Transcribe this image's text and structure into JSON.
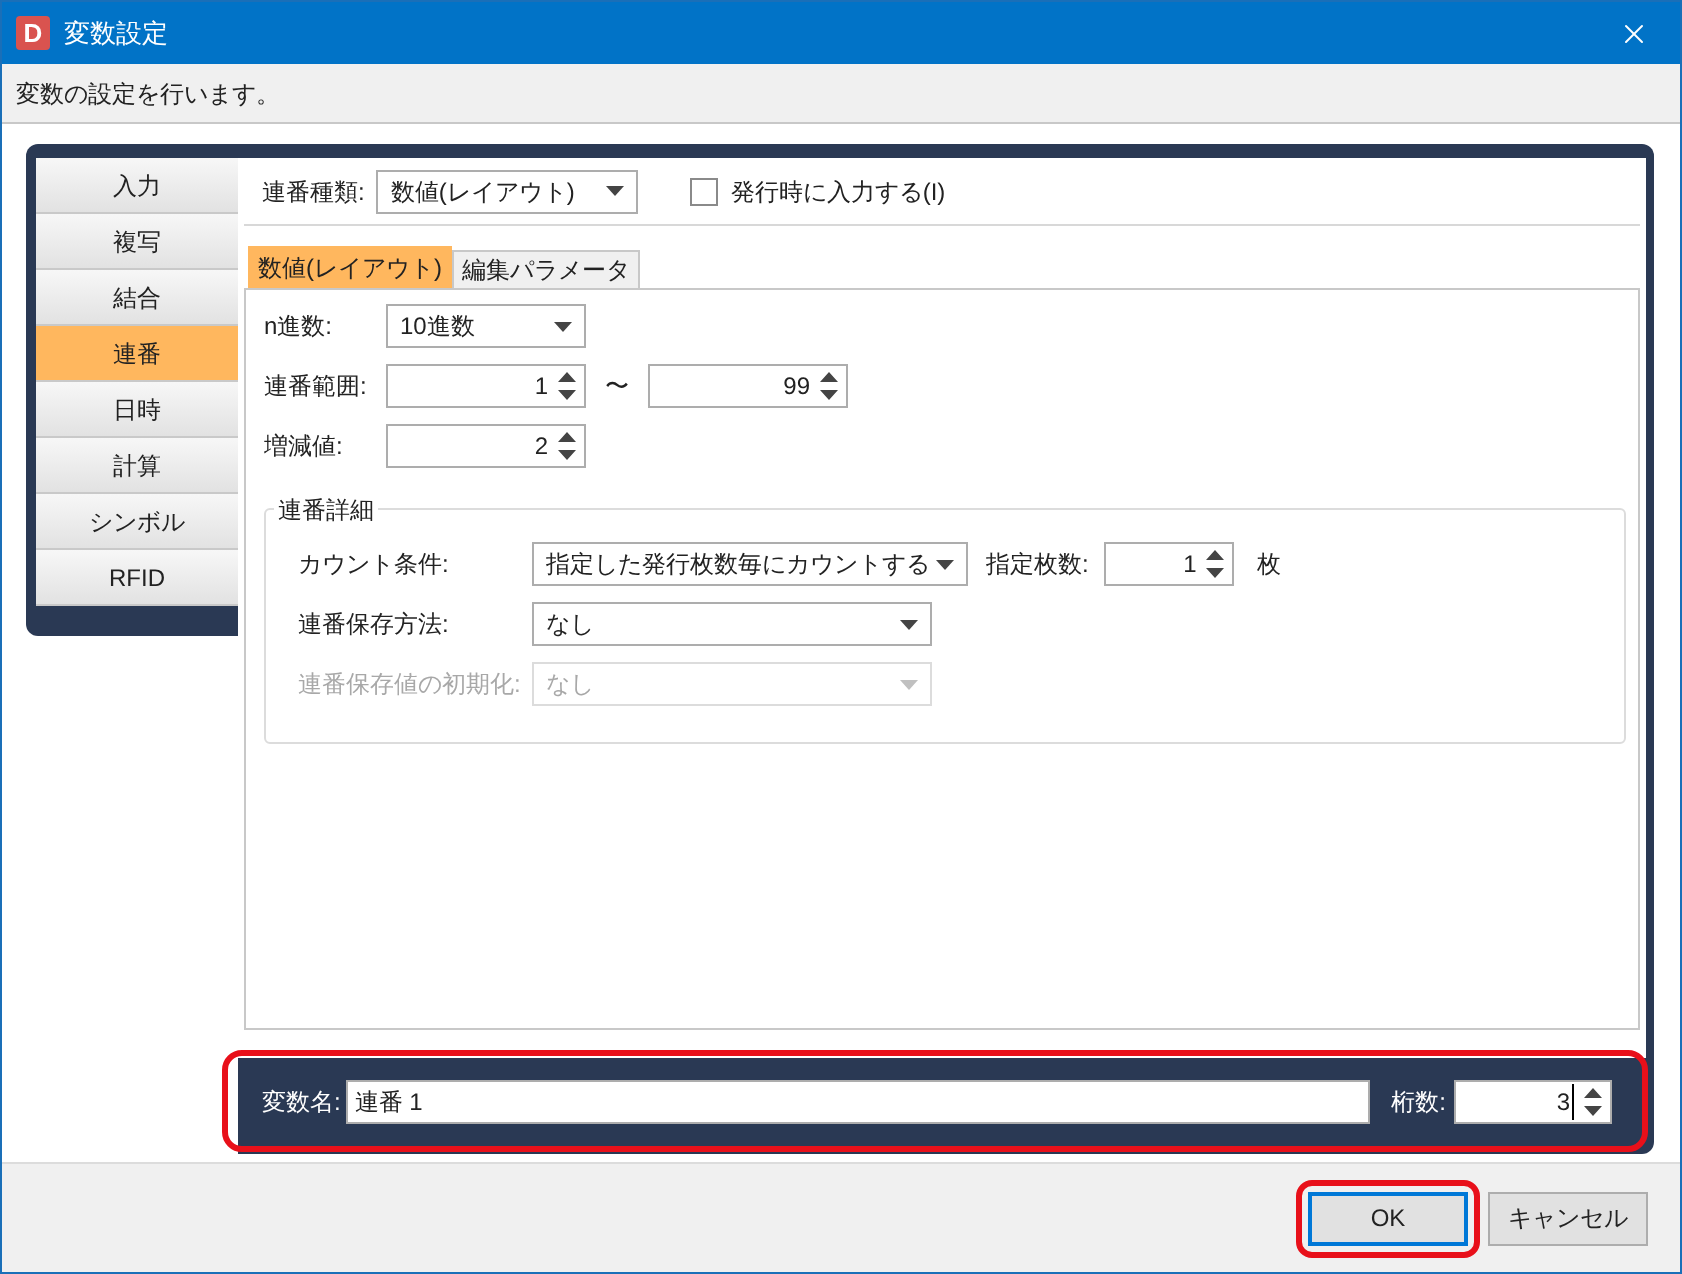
{
  "window": {
    "icon_letter": "D",
    "title": "変数設定"
  },
  "description": "変数の設定を行います。",
  "nav": [
    {
      "label": "入力",
      "selected": false
    },
    {
      "label": "複写",
      "selected": false
    },
    {
      "label": "結合",
      "selected": false
    },
    {
      "label": "連番",
      "selected": true
    },
    {
      "label": "日時",
      "selected": false
    },
    {
      "label": "計算",
      "selected": false
    },
    {
      "label": "シンボル",
      "selected": false
    },
    {
      "label": "RFID",
      "selected": false
    }
  ],
  "sequence_type": {
    "label": "連番種類:",
    "value": "数値(レイアウト)"
  },
  "input_on_issue": {
    "label": "発行時に入力する(I)",
    "checked": false
  },
  "tabs": [
    {
      "label": "数値(レイアウト)",
      "selected": true
    },
    {
      "label": "編集パラメータ",
      "selected": false
    }
  ],
  "radix": {
    "label": "n進数:",
    "value": "10進数"
  },
  "range": {
    "label": "連番範囲:",
    "from": "1",
    "separator": "〜",
    "to": "99"
  },
  "step": {
    "label": "増減値:",
    "value": "2"
  },
  "details": {
    "title": "連番詳細",
    "rows": [
      {
        "kind": "count",
        "label": "カウント条件:",
        "value": "指定した発行枚数毎にカウントする",
        "disabled": false,
        "count_label": "指定枚数:",
        "count": "1",
        "unit": "枚"
      },
      {
        "kind": "select",
        "label": "連番保存方法:",
        "value": "なし",
        "disabled": false
      },
      {
        "kind": "select",
        "label": "連番保存値の初期化:",
        "value": "なし",
        "disabled": true
      }
    ]
  },
  "variable": {
    "name_label": "変数名:",
    "name": "連番 1",
    "digits_label": "桁数:",
    "digits": "3",
    "highlighted": true
  },
  "buttons": [
    {
      "label": "OK",
      "focused": true,
      "highlighted": true
    },
    {
      "label": "キャンセル",
      "focused": false,
      "highlighted": false
    }
  ]
}
